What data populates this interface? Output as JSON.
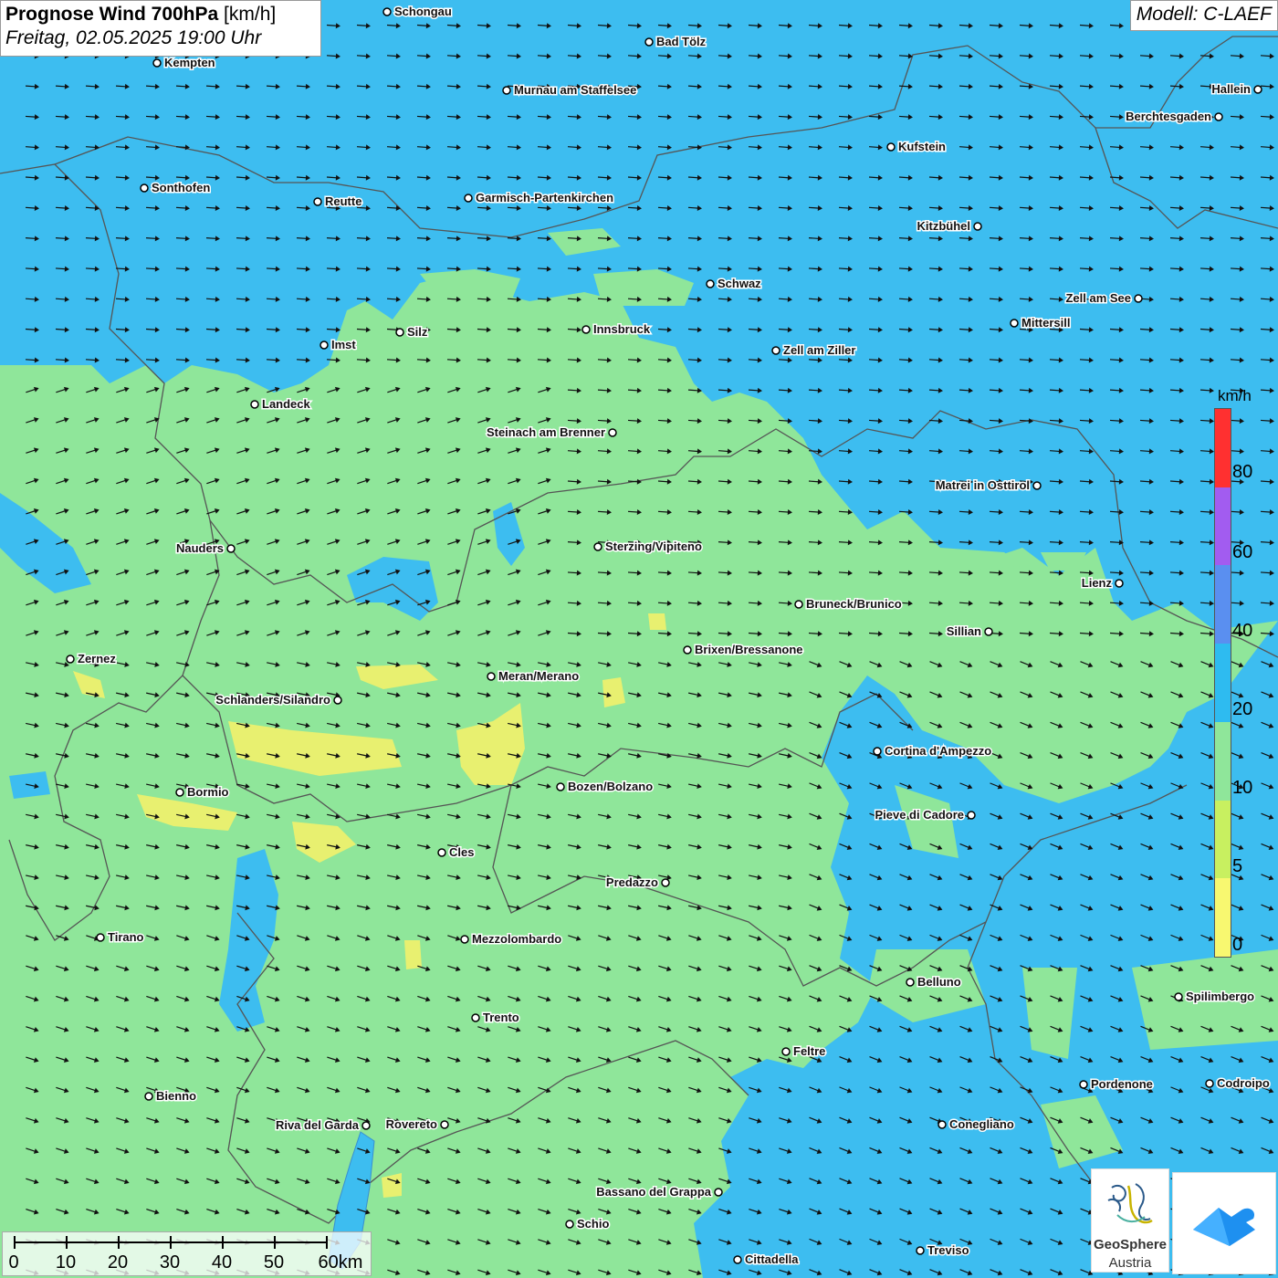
{
  "title": {
    "bold": "Prognose Wind 700hPa",
    "unit": "[km/h]",
    "date": "Freitag, 02.05.2025 19:00 Uhr"
  },
  "model": "Modell: C-LAEF",
  "legend": {
    "unit": "km/h",
    "labels": [
      "80",
      "60",
      "40",
      "20",
      "10",
      "5",
      "0"
    ],
    "colors": [
      "#ff3030",
      "#a25cf0",
      "#5a8ff0",
      "#2ebbf0",
      "#8fe69a",
      "#c8f060",
      "#f8f870"
    ]
  },
  "scalebar": {
    "labels": [
      "0",
      "10",
      "20",
      "30",
      "40",
      "50",
      "60km"
    ]
  },
  "logo": {
    "name": "GeoSphere",
    "sub": "Austria"
  },
  "colors": {
    "blue_area": "#3dbdf0",
    "green_area": "#8fe69a",
    "yellow_area": "#e8f070",
    "arrow": "#111111",
    "border": "#555555"
  },
  "cities": [
    {
      "name": "Schongau"
    },
    {
      "name": "Bad Tölz"
    },
    {
      "name": "Kempten"
    },
    {
      "name": "Murnau am Staffelsee"
    },
    {
      "name": "Hallein"
    },
    {
      "name": "Berchtesgaden"
    },
    {
      "name": "Kufstein"
    },
    {
      "name": "Sonthofen"
    },
    {
      "name": "Reutte"
    },
    {
      "name": "Garmisch-Partenkirchen"
    },
    {
      "name": "Kitzbühel"
    },
    {
      "name": "Schwaz"
    },
    {
      "name": "Zell am See"
    },
    {
      "name": "Innsbruck"
    },
    {
      "name": "Mittersill"
    },
    {
      "name": "Silz"
    },
    {
      "name": "Imst"
    },
    {
      "name": "Zell am Ziller"
    },
    {
      "name": "Landeck"
    },
    {
      "name": "Steinach am Brenner"
    },
    {
      "name": "Matrei in Osttirol"
    },
    {
      "name": "Nauders"
    },
    {
      "name": "Sterzing/Vipiteno"
    },
    {
      "name": "Lienz"
    },
    {
      "name": "Bruneck/Brunico"
    },
    {
      "name": "Sillian"
    },
    {
      "name": "Brixen/Bressanone"
    },
    {
      "name": "Zernez"
    },
    {
      "name": "Meran/Merano"
    },
    {
      "name": "Schlanders/Silandro"
    },
    {
      "name": "Cortina d'Ampezzo"
    },
    {
      "name": "Bozen/Bolzano"
    },
    {
      "name": "Bormio"
    },
    {
      "name": "Pieve di Cadore"
    },
    {
      "name": "Cles"
    },
    {
      "name": "Predazzo"
    },
    {
      "name": "Tirano"
    },
    {
      "name": "Mezzolombardo"
    },
    {
      "name": "Belluno"
    },
    {
      "name": "Spilimbergo"
    },
    {
      "name": "Trento"
    },
    {
      "name": "Feltre"
    },
    {
      "name": "Bienno"
    },
    {
      "name": "Pordenone"
    },
    {
      "name": "Codroipo"
    },
    {
      "name": "Riva del Garda"
    },
    {
      "name": "Rovereto"
    },
    {
      "name": "Conegliano"
    },
    {
      "name": "Bassano del Grappa"
    },
    {
      "name": "Schio"
    },
    {
      "name": "Treviso"
    },
    {
      "name": "Cittadella"
    }
  ]
}
